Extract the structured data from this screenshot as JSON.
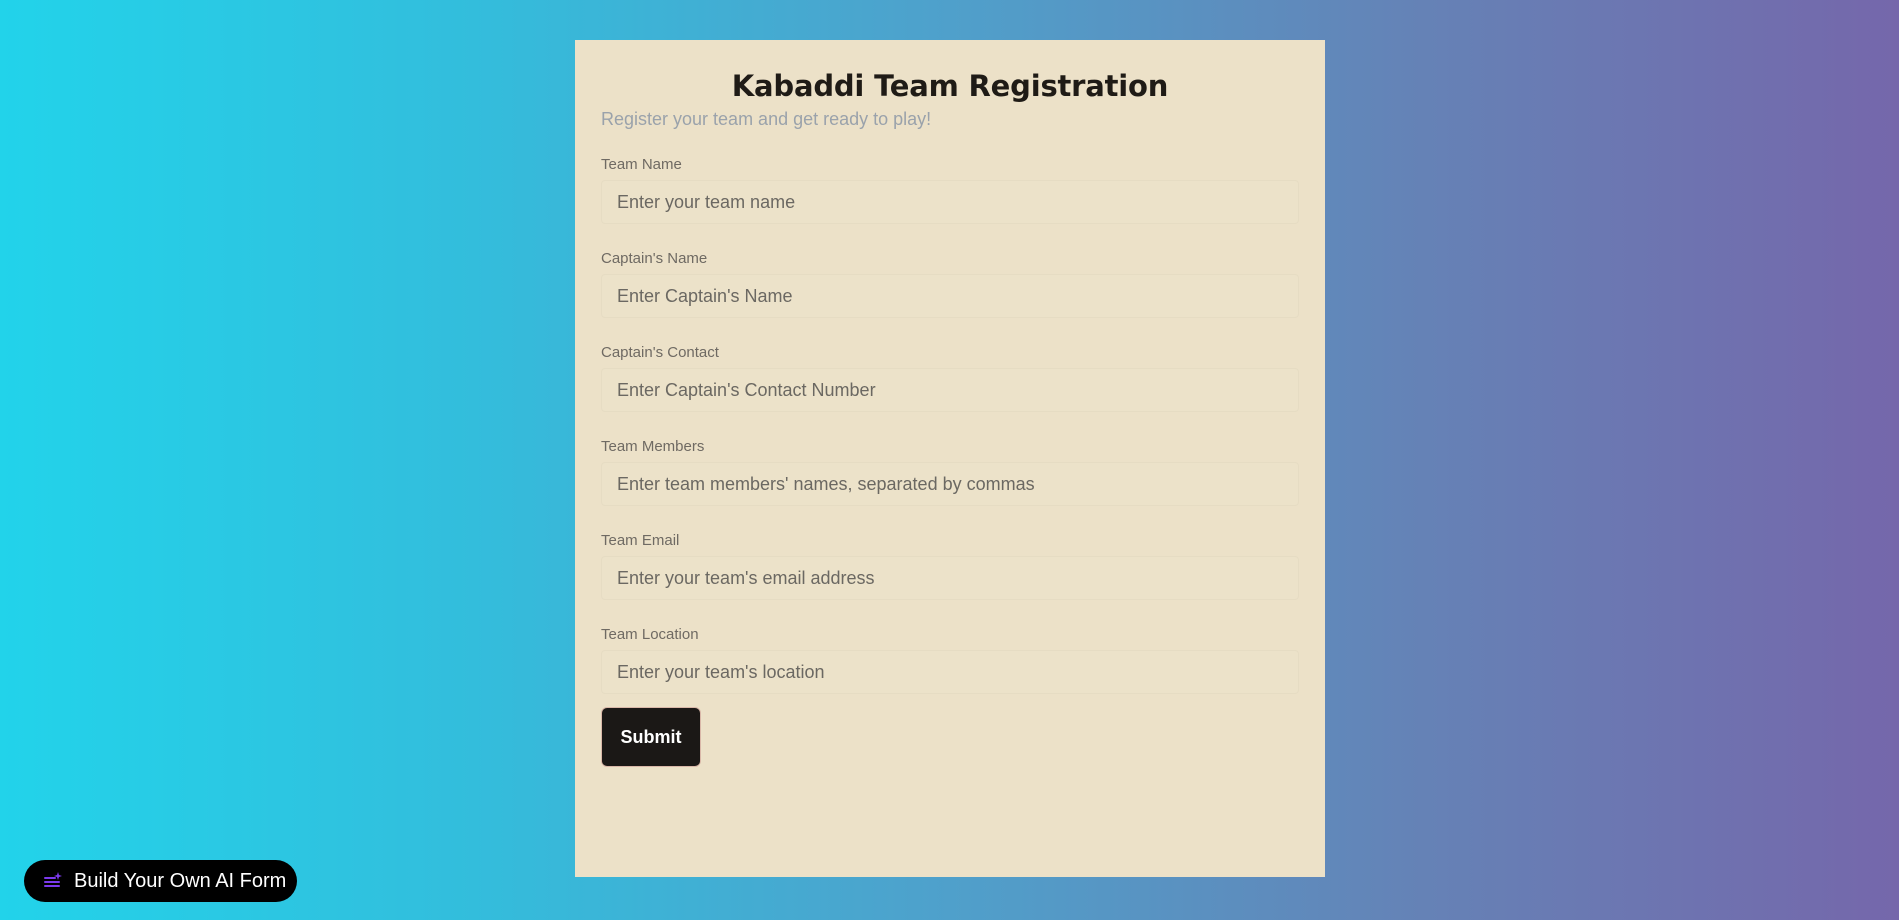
{
  "form": {
    "title": "Kabaddi Team Registration",
    "subtitle": "Register your team and get ready to play!",
    "fields": [
      {
        "label": "Team Name",
        "placeholder": "Enter your team name",
        "value": ""
      },
      {
        "label": "Captain's Name",
        "placeholder": "Enter Captain's Name",
        "value": ""
      },
      {
        "label": "Captain's Contact",
        "placeholder": "Enter Captain's Contact Number",
        "value": ""
      },
      {
        "label": "Team Members",
        "placeholder": "Enter team members' names, separated by commas",
        "value": ""
      },
      {
        "label": "Team Email",
        "placeholder": "Enter your team's email address",
        "value": ""
      },
      {
        "label": "Team Location",
        "placeholder": "Enter your team's location",
        "value": ""
      }
    ],
    "submit_label": "Submit"
  },
  "badge": {
    "label": "Build Your Own AI Form",
    "icon": "ai-form-builder-icon",
    "icon_color": "#7c3aed"
  },
  "colors": {
    "background_gradient": [
      "#22d3ea",
      "#7567ab"
    ],
    "card_background": "#ece1c8",
    "button_background": "#1b1816"
  }
}
